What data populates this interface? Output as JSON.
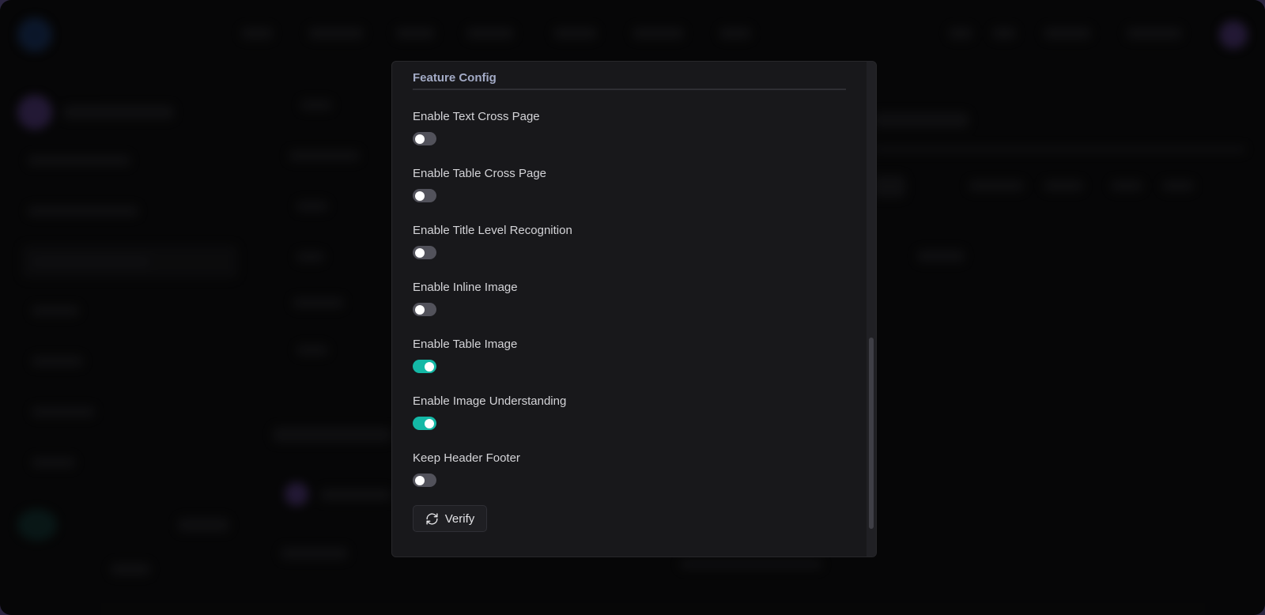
{
  "modal": {
    "section_title": "Feature Config",
    "items": [
      {
        "label": "Enable Text Cross Page",
        "enabled": false
      },
      {
        "label": "Enable Table Cross Page",
        "enabled": false
      },
      {
        "label": "Enable Title Level Recognition",
        "enabled": false
      },
      {
        "label": "Enable Inline Image",
        "enabled": false
      },
      {
        "label": "Enable Table Image",
        "enabled": true
      },
      {
        "label": "Enable Image Understanding",
        "enabled": true
      },
      {
        "label": "Keep Header Footer",
        "enabled": false
      }
    ],
    "verify_label": "Verify",
    "verify_icon": "refresh-icon"
  },
  "colors": {
    "toggle_on": "#14b8a6",
    "toggle_off": "#52525b",
    "modal_bg": "#18181b",
    "section_title": "#a3abc6"
  }
}
